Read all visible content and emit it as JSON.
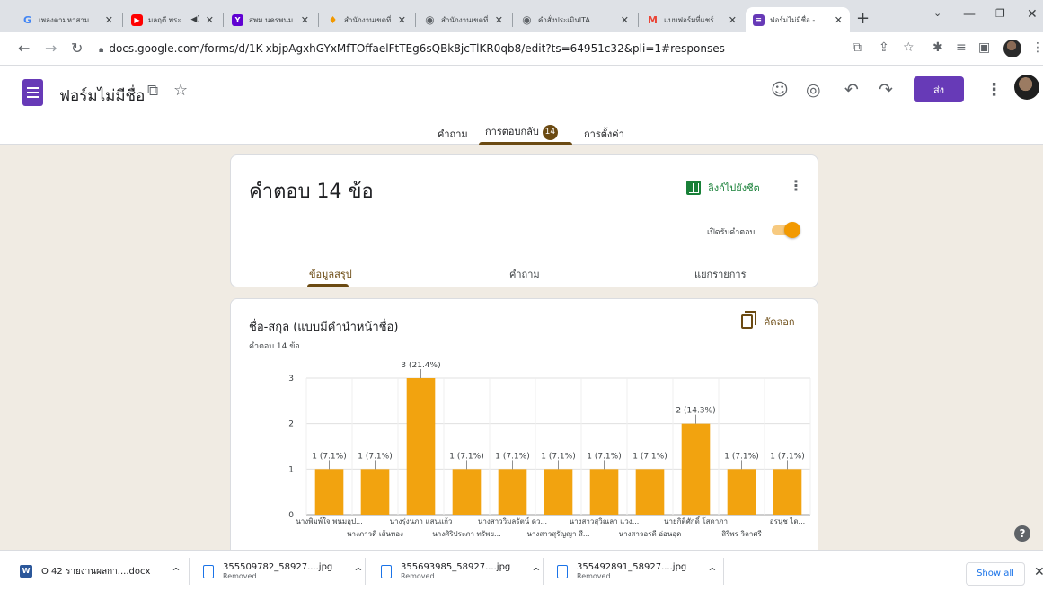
{
  "browser": {
    "tabs": [
      {
        "title": "เพลงตามหาสาม",
        "icon": "google-icon",
        "color": "#4285f4",
        "active": false
      },
      {
        "title": "มลฤดี พระ",
        "icon": "youtube-icon",
        "color": "#ff0000",
        "active": false
      },
      {
        "title": "สพม.นครพนม",
        "icon": "yahoo-icon",
        "color": "#6001d2",
        "active": false
      },
      {
        "title": "สำนักงานเขตที่",
        "icon": "flame-icon",
        "color": "#f29900",
        "active": false
      },
      {
        "title": "สำนักงานเขตที่",
        "icon": "globe-icon",
        "color": "#5f6368",
        "active": false
      },
      {
        "title": "คำสั่งประเมินITA",
        "icon": "globe-icon",
        "color": "#5f6368",
        "active": false
      },
      {
        "title": "แบบฟอร์มที่แชร์",
        "icon": "gmail-icon",
        "color": "#ea4335",
        "active": false
      },
      {
        "title": "ฟอร์มไม่มีชื่อ -",
        "icon": "forms-icon",
        "color": "#673ab7",
        "active": true
      }
    ],
    "url": "docs.google.com/forms/d/1K-xbjpAgxhGYxMfTOffaelFtTEg6sQBk8jcTlKR0qb8/edit?ts=64951c32&pli=1#responses"
  },
  "header": {
    "form_title": "ฟอร์มไม่มีชื่อ",
    "send_label": "ส่ง",
    "tabs": {
      "questions": "คำถาม",
      "responses": "การตอบกลับ",
      "settings": "การตั้งค่า"
    },
    "response_badge": "14"
  },
  "summary_card": {
    "title": "คำตอบ 14 ข้อ",
    "sheet_link": "ลิงก์ไปยังชีต",
    "accepting_label": "เปิดรับคำตอบ",
    "subtabs": {
      "summary": "ข้อมูลสรุป",
      "question": "คำถาม",
      "individual": "แยกรายการ"
    }
  },
  "question_card": {
    "title": "ชื่อ-สกุล (แบบมีคำนำหน้าชื่อ)",
    "count": "คำตอบ 14 ข้อ",
    "copy_label": "คัดลอก"
  },
  "chart_data": {
    "type": "bar",
    "categories": [
      "นางพิมพ์ใจ พนมอุป...",
      "นางภาวดี เส้นทอง",
      "นางรุ่งนภา แสนแก้ว",
      "นางศิริประภา ทรัพย...",
      "นางสาววิมลรัตน์ ดว...",
      "นางสาวสุรัญญา สี...",
      "นางสาวสุวิณลา แวง...",
      "นางสาวอรดี อ่อนอุด",
      "นายกิติศักดิ์ โสดาภา",
      "สิริพร วิลาศรี",
      "อรนุช ได..."
    ],
    "values": [
      1,
      1,
      3,
      1,
      1,
      1,
      1,
      1,
      2,
      1,
      1
    ],
    "data_labels": [
      "1 (7.1%)",
      "1 (7.1%)",
      "3 (21.4%)",
      "1 (7.1%)",
      "1 (7.1%)",
      "1 (7.1%)",
      "1 (7.1%)",
      "1 (7.1%)",
      "2 (14.3%)",
      "1 (7.1%)",
      "1 (7.1%)"
    ],
    "yticks": [
      "0",
      "1",
      "2",
      "3"
    ],
    "ylim": [
      0,
      3
    ],
    "grid": true,
    "bar_color": "#f2a30f"
  },
  "downloads": [
    {
      "name": "O 42 รายงานผลกา....docx",
      "status": "",
      "icon": "word-doc-icon"
    },
    {
      "name": "355509782_58927....jpg",
      "status": "Removed",
      "icon": "image-file-icon"
    },
    {
      "name": "355693985_58927....jpg",
      "status": "Removed",
      "icon": "image-file-icon"
    },
    {
      "name": "355492891_58927....jpg",
      "status": "Removed",
      "icon": "image-file-icon"
    }
  ],
  "show_all_label": "Show all",
  "colors": {
    "forms_purple": "#673ab7",
    "accent_brown": "#6b4a12",
    "sheets_green": "#188038",
    "background": "#f0ebe3"
  }
}
